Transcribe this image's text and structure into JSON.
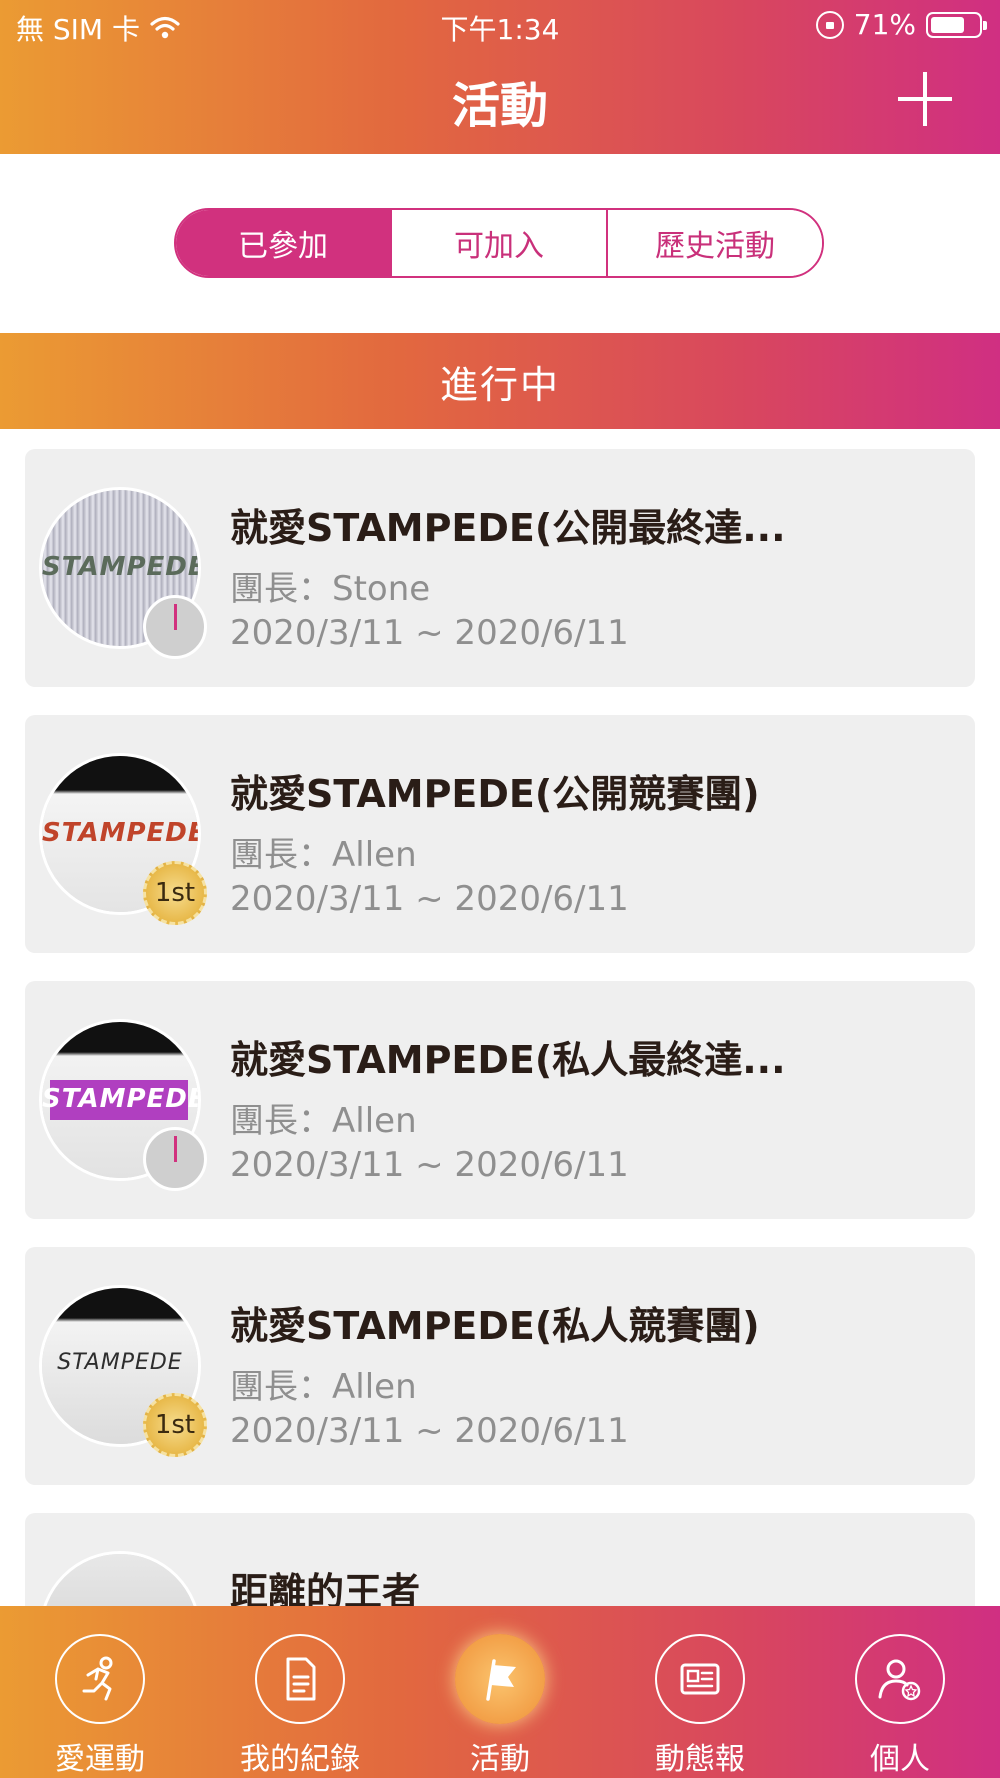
{
  "status_bar": {
    "carrier": "無 SIM 卡",
    "time": "下午1:34",
    "battery_percent": "71%",
    "battery_level": 0.71
  },
  "header": {
    "title": "活動",
    "add_icon": "plus-icon"
  },
  "segments": {
    "items": [
      "已參加",
      "可加入",
      "歷史活動"
    ],
    "selected": "已參加"
  },
  "section": {
    "title": "進行中"
  },
  "events": [
    {
      "name": "就愛STAMPEDE(公開最終達...",
      "leader": "團長：Stone",
      "dates": "2020/3/11 ~ 2020/6/11",
      "badge": "timer-icon",
      "logo_text": "STAMPEDE",
      "logo_color": "#5b6b5b"
    },
    {
      "name": "就愛STAMPEDE(公開競賽團)",
      "leader": "團長：Allen",
      "dates": "2020/3/11 ~ 2020/6/11",
      "badge": "first-place-medal-icon",
      "badge_text": "1st",
      "logo_text": "STAMPEDE",
      "logo_color": "#c0442a"
    },
    {
      "name": "就愛STAMPEDE(私人最終達...",
      "leader": "團長：Allen",
      "dates": "2020/3/11 ~ 2020/6/11",
      "badge": "timer-icon",
      "logo_text": "STAMPEDE",
      "logo_color": "#ffffff"
    },
    {
      "name": "就愛STAMPEDE(私人競賽團)",
      "leader": "團長：Allen",
      "dates": "2020/3/11 ~ 2020/6/11",
      "badge": "first-place-medal-icon",
      "badge_text": "1st",
      "logo_text": "STAMPEDE",
      "logo_color": "#2d2d2d"
    },
    {
      "name": "距離的王者",
      "leader": "",
      "dates": "",
      "badge": "",
      "logo_text": "",
      "logo_color": "#777777"
    }
  ],
  "tabbar": {
    "items": [
      {
        "label": "愛運動",
        "icon": "running-icon"
      },
      {
        "label": "我的紀錄",
        "icon": "document-icon"
      },
      {
        "label": "活動",
        "icon": "flag-icon"
      },
      {
        "label": "動態報",
        "icon": "newspaper-icon"
      },
      {
        "label": "個人",
        "icon": "profile-icon"
      }
    ],
    "active": "活動"
  },
  "colors": {
    "gradient_start": "#eb9b33",
    "gradient_end": "#d02f82",
    "accent": "#d1317e"
  }
}
